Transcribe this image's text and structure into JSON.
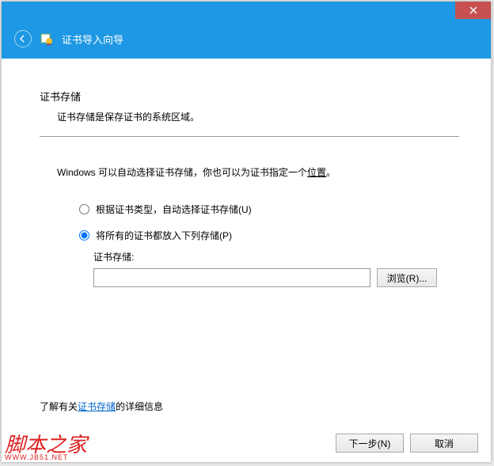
{
  "header": {
    "title": "证书导入向导"
  },
  "section": {
    "title": "证书存储",
    "desc": "证书存储是保存证书的系统区域。"
  },
  "body": {
    "intro_prefix": "Windows 可以自动选择证书存储，你也可以为证书指定一个",
    "intro_link": "位置",
    "intro_suffix": "。"
  },
  "radios": {
    "auto": "根据证书类型，自动选择证书存储(U)",
    "manual": "将所有的证书都放入下列存储(P)"
  },
  "store": {
    "label": "证书存储:",
    "value": "",
    "browse": "浏览(R)..."
  },
  "learn_more": {
    "prefix": "了解有关",
    "link": "证书存储",
    "suffix": "的详细信息"
  },
  "footer": {
    "next": "下一步(N)",
    "cancel": "取消"
  },
  "watermark": {
    "text": "脚本之家",
    "url": "WWW.JB51.NET"
  }
}
